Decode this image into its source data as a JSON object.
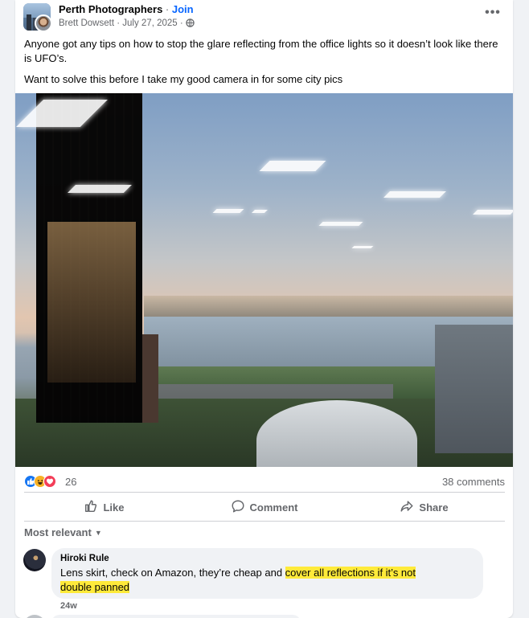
{
  "post": {
    "group_name": "Perth Photographers",
    "separator": " · ",
    "join_label": "Join",
    "author": "Brett Dowsett",
    "date": "July 27, 2025",
    "text_line1": "Anyone got any tips on how to stop the glare reflecting from the office lights so it doesn’t look like there is UFO’s.",
    "text_line2": "Want to solve this before I take my good camera in for some city pics",
    "more_label": "•••"
  },
  "stats": {
    "reaction_count": "26",
    "comments_count": "38 comments",
    "reactions": [
      "like-icon",
      "haha-icon",
      "love-icon"
    ]
  },
  "actions": {
    "like": "Like",
    "comment": "Comment",
    "share": "Share"
  },
  "comments": {
    "sort_label": "Most relevant",
    "items": [
      {
        "author": "Hiroki Rule",
        "text_plain": "Lens skirt, check on Amazon, they’re cheap and ",
        "text_highlight_1": "cover all reflections if it’s not",
        "text_highlight_2": "double panned",
        "time": "24w"
      }
    ]
  },
  "colors": {
    "accent": "#0866ff",
    "highlight": "#ffea3a",
    "secondary_text": "#65676b"
  }
}
